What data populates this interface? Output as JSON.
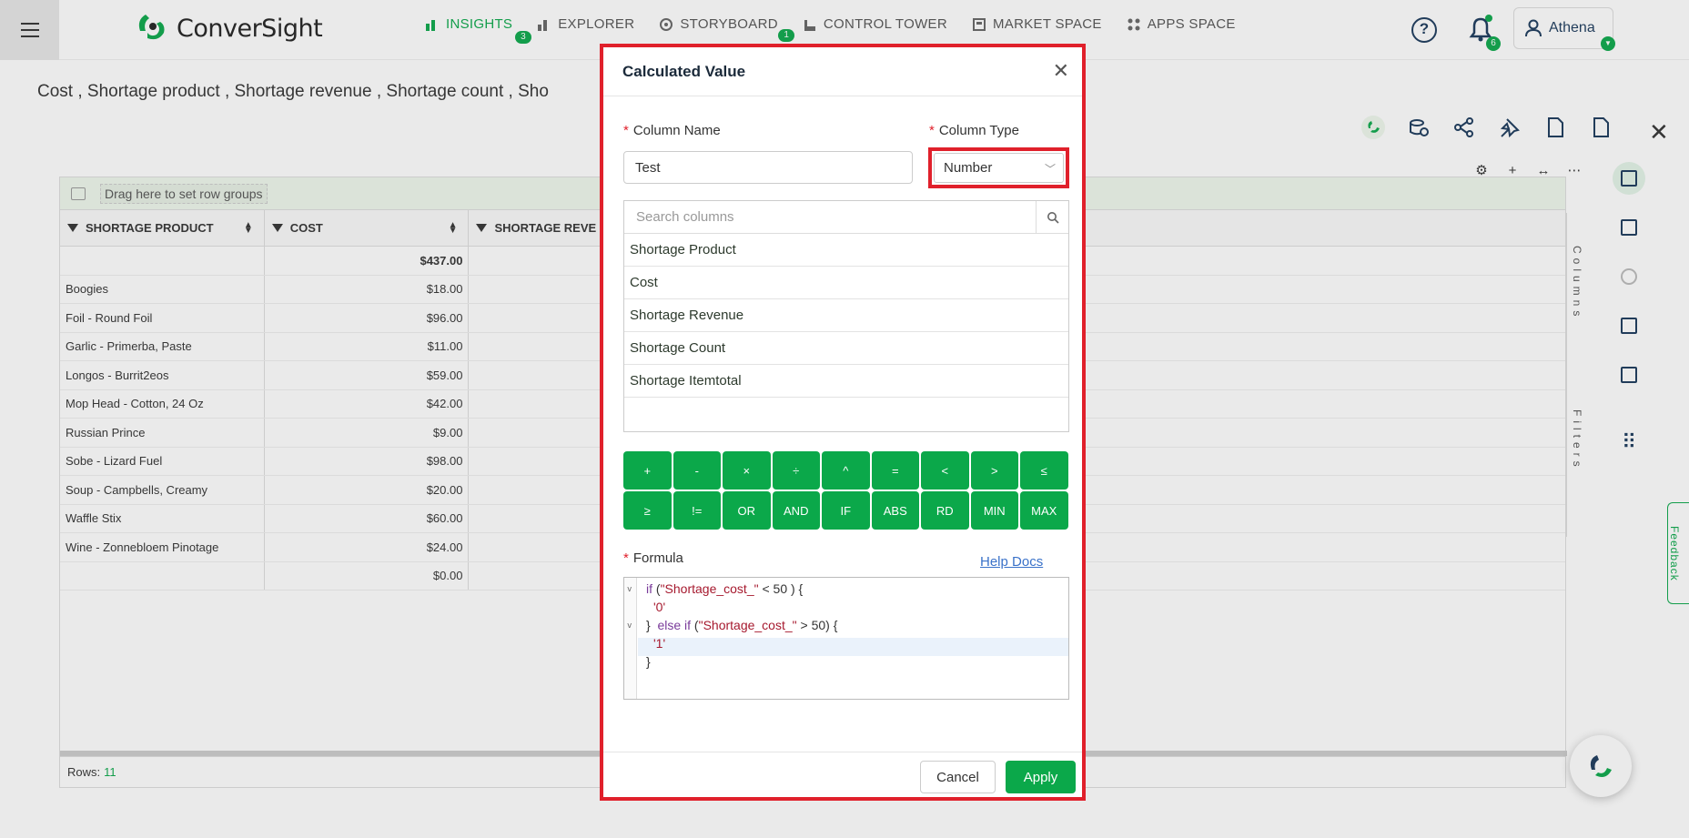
{
  "app": {
    "brand": "ConverSight",
    "nav": [
      {
        "label": "INSIGHTS",
        "badge": "3"
      },
      {
        "label": "EXPLORER",
        "badge": ""
      },
      {
        "label": "STORYBOARD",
        "badge": "1"
      },
      {
        "label": "CONTROL TOWER",
        "badge": ""
      },
      {
        "label": "MARKET SPACE",
        "badge": ""
      },
      {
        "label": "APPS SPACE",
        "badge": ""
      }
    ],
    "notifications_badge": "6",
    "user_name": "Athena"
  },
  "page": {
    "title": "Cost , Shortage product , Shortage revenue , Shortage count , Sho",
    "group_hint": "Drag here to set row groups",
    "columns": [
      "SHORTAGE PRODUCT",
      "COST",
      "SHORTAGE REVE"
    ],
    "total_cost": "$437.00",
    "rows": [
      {
        "product": "Boogies",
        "cost": "$18.00"
      },
      {
        "product": "Foil - Round Foil",
        "cost": "$96.00"
      },
      {
        "product": "Garlic - Primerba, Paste",
        "cost": "$11.00"
      },
      {
        "product": "Longos - Burrit2eos",
        "cost": "$59.00"
      },
      {
        "product": "Mop Head - Cotton, 24 Oz",
        "cost": "$42.00"
      },
      {
        "product": "Russian Prince",
        "cost": "$9.00"
      },
      {
        "product": "Sobe - Lizard Fuel",
        "cost": "$98.00"
      },
      {
        "product": "Soup - Campbells, Creamy",
        "cost": "$20.00"
      },
      {
        "product": "Waffle Stix",
        "cost": "$60.00"
      },
      {
        "product": "Wine - Zonnebloem Pinotage",
        "cost": "$24.00"
      },
      {
        "product": "",
        "cost": "$0.00"
      }
    ],
    "rows_label": "Rows:",
    "rows_count": "11",
    "side_tabs": [
      "Columns",
      "Filters"
    ],
    "feedback": "Feedback"
  },
  "modal": {
    "title": "Calculated Value",
    "column_name_label": "Column Name",
    "column_name_value": "Test",
    "column_type_label": "Column Type",
    "column_type_value": "Number",
    "search_placeholder": "Search columns",
    "column_options": [
      "Shortage Product",
      "Cost",
      "Shortage Revenue",
      "Shortage Count",
      "Shortage Itemtotal"
    ],
    "operators_row1": [
      "+",
      "-",
      "×",
      "÷",
      "^",
      "=",
      "<",
      ">",
      "≤"
    ],
    "operators_row2": [
      "≥",
      "!=",
      "OR",
      "AND",
      "IF",
      "ABS",
      "RD",
      "MIN",
      "MAX"
    ],
    "formula_label": "Formula",
    "help_docs": "Help Docs",
    "formula_lines": [
      "if (\"Shortage_cost_\" < 50 ) {",
      "  '0'",
      "}  else if (\"Shortage_cost_\" > 50) {",
      "  '1'",
      "}"
    ],
    "cancel_label": "Cancel",
    "apply_label": "Apply"
  },
  "colors": {
    "accent": "#0ba84a",
    "highlight": "#e0202b",
    "navy": "#1b3a5c"
  }
}
